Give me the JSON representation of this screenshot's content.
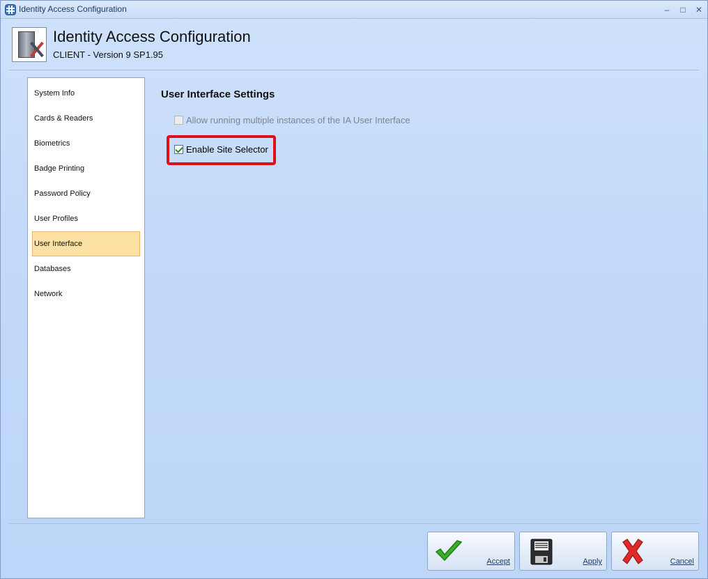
{
  "window": {
    "title": "Identity Access Configuration",
    "minimize_glyph": "–",
    "maximize_glyph": "□",
    "close_glyph": "✕"
  },
  "header": {
    "title": "Identity Access Configuration",
    "subtitle": "CLIENT - Version 9 SP1.95",
    "icon": "server-tools-icon"
  },
  "sidebar": {
    "items": [
      {
        "label": "System Info",
        "active": false
      },
      {
        "label": "Cards & Readers",
        "active": false
      },
      {
        "label": "Biometrics",
        "active": false
      },
      {
        "label": "Badge Printing",
        "active": false
      },
      {
        "label": "Password Policy",
        "active": false
      },
      {
        "label": "User Profiles",
        "active": false
      },
      {
        "label": "User Interface",
        "active": true
      },
      {
        "label": "Databases",
        "active": false
      },
      {
        "label": "Network",
        "active": false
      }
    ]
  },
  "main": {
    "section_title": "User Interface Settings",
    "options": [
      {
        "label": "Allow running multiple instances of the IA User Interface",
        "checked": false,
        "enabled": false
      },
      {
        "label": "Enable Site Selector",
        "checked": true,
        "enabled": true
      }
    ],
    "highlight_color": "#e0101b"
  },
  "footer": {
    "accept_label": "Accept",
    "apply_label": "Apply",
    "cancel_label": "Cancel"
  },
  "colors": {
    "background": "#c4dafa",
    "active_item": "#fde1a4",
    "accept_green": "#3cae2a",
    "cancel_red": "#e02a2a"
  }
}
